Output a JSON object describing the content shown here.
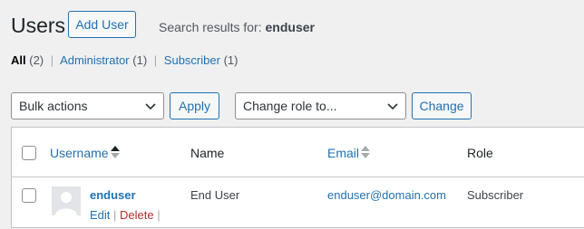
{
  "header": {
    "title": "Users",
    "add_user_label": "Add User",
    "search_prefix": "Search results for: ",
    "search_term": "enduser"
  },
  "filters": {
    "all_label": "All",
    "all_count": "(2)",
    "administrator_label": "Administrator",
    "administrator_count": "(1)",
    "subscriber_label": "Subscriber",
    "subscriber_count": "(1)",
    "separator": "|"
  },
  "bulk": {
    "bulk_actions_value": "Bulk actions",
    "apply_label": "Apply",
    "change_role_value": "Change role to...",
    "change_label": "Change"
  },
  "table": {
    "columns": {
      "username": "Username",
      "name": "Name",
      "email": "Email",
      "role": "Role"
    },
    "rows": [
      {
        "username": "enduser",
        "name": "End User",
        "email": "enduser@domain.com",
        "role": "Subscriber",
        "actions": {
          "edit": "Edit",
          "delete": "Delete",
          "sep": "|"
        }
      }
    ]
  },
  "colors": {
    "accent": "#2271b1",
    "delete": "#b32d2e",
    "background": "#f0f0f1"
  },
  "icons": {
    "sort": "sort-arrows-icon",
    "chevron": "chevron-down-icon",
    "avatar": "default-avatar"
  }
}
